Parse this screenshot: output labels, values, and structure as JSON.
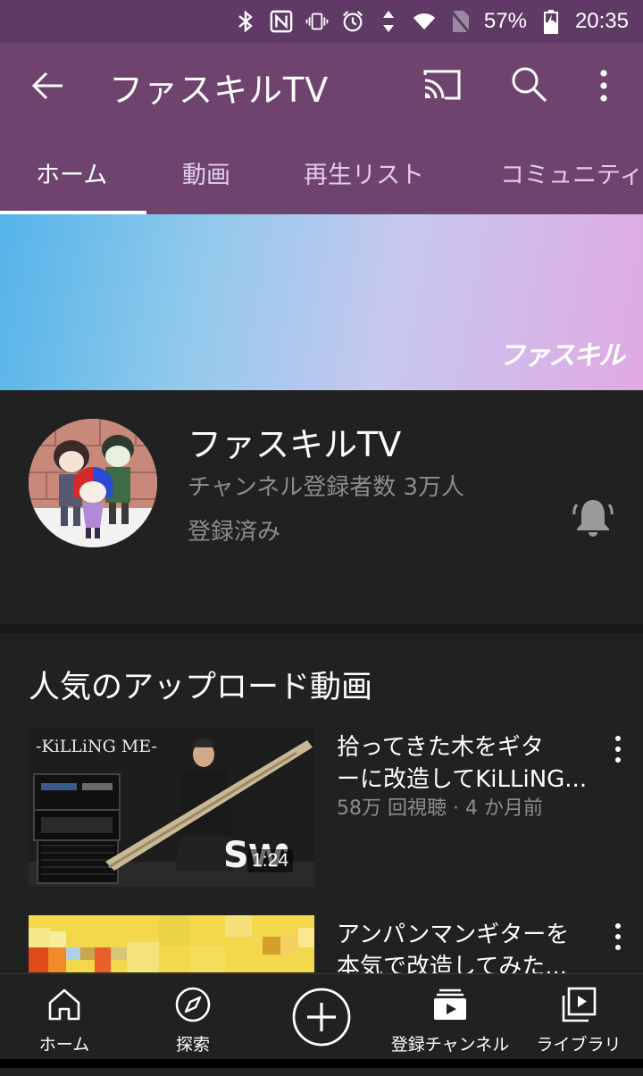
{
  "status_bar": {
    "battery_percent": "57%",
    "time": "20:35",
    "icons": [
      "bluetooth-icon",
      "nfc-icon",
      "vibrate-icon",
      "alarm-icon",
      "data-arrows-icon",
      "wifi-icon",
      "no-sim-icon",
      "battery-icon"
    ]
  },
  "app_bar": {
    "title": "ファスキルTV",
    "icons": [
      "back-arrow-icon",
      "cast-icon",
      "search-icon",
      "more-vert-icon"
    ]
  },
  "tabs": [
    {
      "label": "ホーム",
      "active": true
    },
    {
      "label": "動画",
      "active": false
    },
    {
      "label": "再生リスト",
      "active": false
    },
    {
      "label": "コミュニティ",
      "active": false
    }
  ],
  "banner": {
    "logo_text": "ファスキル"
  },
  "channel": {
    "name": "ファスキルTV",
    "subscribers": "チャンネル登録者数 3万人",
    "subscription_status": "登録済み"
  },
  "section": {
    "title": "人気のアップロード動画",
    "videos": [
      {
        "title": "拾ってきた木をギターに改造してKiLLiNG...",
        "title_line1": "拾ってきた木をギタ",
        "title_line2": "ーに改造してKiLLiNG...",
        "meta": "58万 回視聴 · 4 か月前",
        "duration": "1:24",
        "thumb_text": "-KiLLiNG ME-"
      },
      {
        "title": "アンパンマンギターを本気で改造してみた...",
        "title_line1": "アンパンマンギターを",
        "title_line2": "本気で改造してみた..."
      }
    ]
  },
  "bottom_nav": [
    {
      "label": "ホーム",
      "icon": "home-icon"
    },
    {
      "label": "探索",
      "icon": "explore-icon"
    },
    {
      "label": "",
      "icon": "add-icon"
    },
    {
      "label": "登録チャンネル",
      "icon": "subscriptions-icon"
    },
    {
      "label": "ライブラリ",
      "icon": "library-icon"
    }
  ],
  "colors": {
    "status_bar": "#5e3a65",
    "app_bar": "#6e446f",
    "background": "#212121",
    "secondary_text": "#8c8c8c"
  }
}
